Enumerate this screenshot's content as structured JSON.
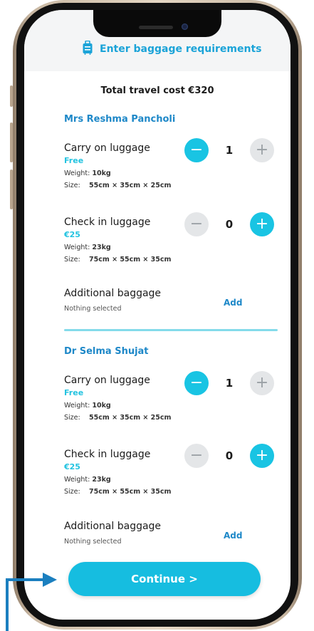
{
  "header": {
    "title": "Enter baggage requirements",
    "icon": "luggage-icon"
  },
  "total_cost": "Total travel cost €320",
  "passengers": [
    {
      "name": "Mrs Reshma Pancholi",
      "carry_on": {
        "title": "Carry on luggage",
        "price": "Free",
        "weight_label": "Weight:",
        "weight": "10kg",
        "size_label": "Size:",
        "size": "55cm × 35cm × 25cm",
        "count": "1"
      },
      "check_in": {
        "title": "Check in luggage",
        "price": "€25",
        "weight_label": "Weight:",
        "weight": "23kg",
        "size_label": "Size:",
        "size": "75cm × 55cm × 35cm",
        "count": "0"
      },
      "additional": {
        "title": "Additional baggage",
        "status": "Nothing selected",
        "action": "Add"
      }
    },
    {
      "name": "Dr Selma Shujat",
      "carry_on": {
        "title": "Carry on luggage",
        "price": "Free",
        "weight_label": "Weight:",
        "weight": "10kg",
        "size_label": "Size:",
        "size": "55cm × 35cm × 25cm",
        "count": "1"
      },
      "check_in": {
        "title": "Check in luggage",
        "price": "€25",
        "weight_label": "Weight:",
        "weight": "23kg",
        "size_label": "Size:",
        "size": "75cm × 55cm × 35cm",
        "count": "0"
      },
      "additional": {
        "title": "Additional baggage",
        "status": "Nothing selected",
        "action": "Add"
      }
    }
  ],
  "stepper": {
    "minus": "−",
    "plus": "+"
  },
  "continue_label": "Continue >",
  "colors": {
    "accent": "#19c4e3",
    "link": "#1e88c8",
    "price": "#23c3e0",
    "disabled": "#e4e6e8"
  }
}
